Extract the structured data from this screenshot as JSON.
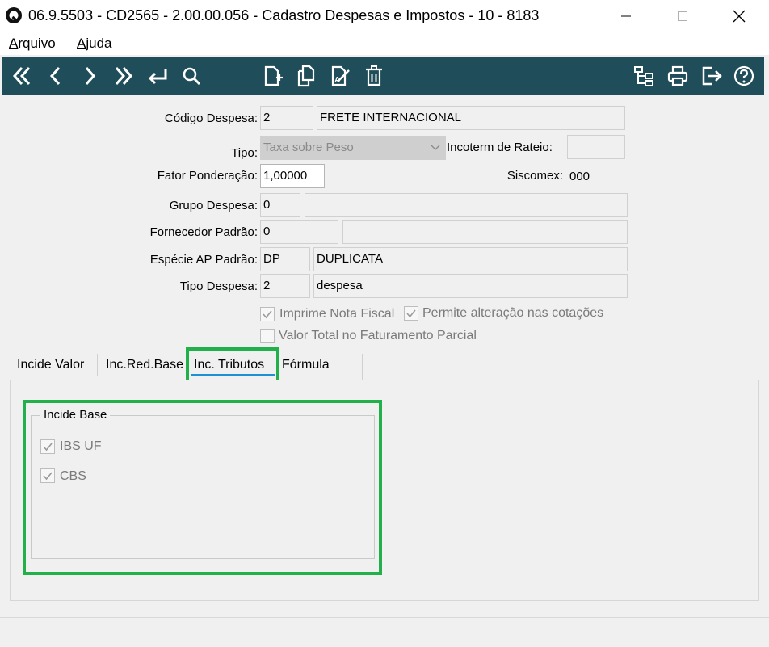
{
  "window": {
    "title": "06.9.5503 - CD2565 - 2.00.00.056 - Cadastro Despesas e Impostos - 10 - 8183",
    "minimize_icon": "minimize-icon",
    "maximize_icon": "maximize-icon",
    "close_icon": "close-icon"
  },
  "menu": {
    "file": "Arquivo",
    "help": "Ajuda"
  },
  "toolbar": {
    "background": "#1f4d5a",
    "left_icons": [
      "first-record-icon",
      "previous-record-icon",
      "next-record-icon",
      "last-record-icon",
      "return-icon",
      "search-icon"
    ],
    "middle_icons": [
      "new-record-icon",
      "copy-record-icon",
      "edit-record-icon",
      "delete-icon"
    ],
    "right_icons": [
      "hierarchy-icon",
      "print-icon",
      "exit-icon",
      "help-icon"
    ]
  },
  "form": {
    "codigo_despesa": {
      "label": "Código Despesa:",
      "code": "2",
      "description": "FRETE INTERNACIONAL"
    },
    "tipo": {
      "label": "Tipo:",
      "value": "Taxa sobre Peso"
    },
    "incoterm": {
      "label": "Incoterm de Rateio:",
      "value": ""
    },
    "fator": {
      "label": "Fator Ponderação:",
      "value": "1,00000"
    },
    "siscomex": {
      "label": "Siscomex:",
      "value": "000"
    },
    "grupo": {
      "label": "Grupo Despesa:",
      "code": "0",
      "description": ""
    },
    "fornecedor": {
      "label": "Fornecedor Padrão:",
      "code": "0",
      "description": ""
    },
    "especie": {
      "label": "Espécie AP Padrão:",
      "code": "DP",
      "description": "DUPLICATA"
    },
    "tipo_despesa": {
      "label": "Tipo Despesa:",
      "code": "2",
      "description": "despesa"
    },
    "imprime_nota": {
      "label": "Imprime Nota Fiscal",
      "checked": true
    },
    "permite_alteracao": {
      "label": "Permite alteração nas cotações",
      "checked": true
    },
    "valor_total": {
      "label": "Valor Total no Faturamento Parcial",
      "checked": false
    }
  },
  "tabs": {
    "incide_valor": "Incide Valor",
    "inc_red_base": "Inc.Red.Base",
    "inc_tributos": "Inc. Tributos",
    "formula": "Fórmula",
    "active_color": "#1e90d8"
  },
  "incide_base": {
    "title": "Incide Base",
    "ibs_uf": {
      "label": "IBS UF",
      "checked": true
    },
    "cbs": {
      "label": "CBS",
      "checked": true
    }
  },
  "highlight_color": "#22b04a"
}
